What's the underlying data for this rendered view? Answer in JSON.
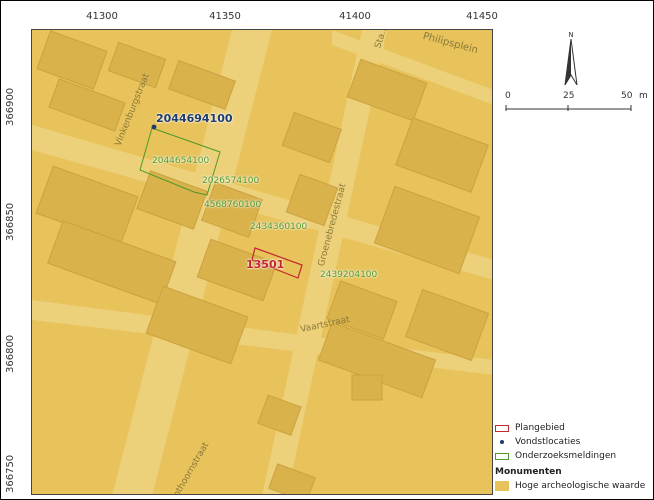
{
  "map": {
    "x_ticks": [
      "41300",
      "41350",
      "41400",
      "41450"
    ],
    "y_ticks": [
      "366900",
      "366850",
      "366800",
      "366750"
    ],
    "streets": [
      "Philipsplein",
      "Vinkenburgstraat",
      "Groenebredestraat",
      "Vaartstraat",
      "Coothoornstraat",
      "Sta..."
    ],
    "site_labels": {
      "main_site": "13501",
      "onderzoek_1": "2044694100",
      "onderzoek_2": "2044654100",
      "onderzoek_3": "2026574100",
      "onderzoek_4": "4568760100",
      "onderzoek_5": "2434360100",
      "onderzoek_6": "2439204100"
    }
  },
  "scale": {
    "labels": [
      "0",
      "25",
      "50"
    ],
    "unit": "m"
  },
  "north": {
    "label": "N"
  },
  "legend": {
    "plangebied": "Plangebied",
    "vondstlocaties": "Vondstlocaties",
    "onderzoeksmeldingen": "Onderzoeksmeldingen",
    "monumenten_heading": "Monumenten",
    "hoge_waarde": "Hoge archeologische waarde"
  },
  "colors": {
    "map_bg": "#e8c25a",
    "plangebied": "#c0282e",
    "onderzoek": "#4f9a2a",
    "vondst": "#1c3b6e",
    "hoge_waarde": "#e8c25a"
  }
}
